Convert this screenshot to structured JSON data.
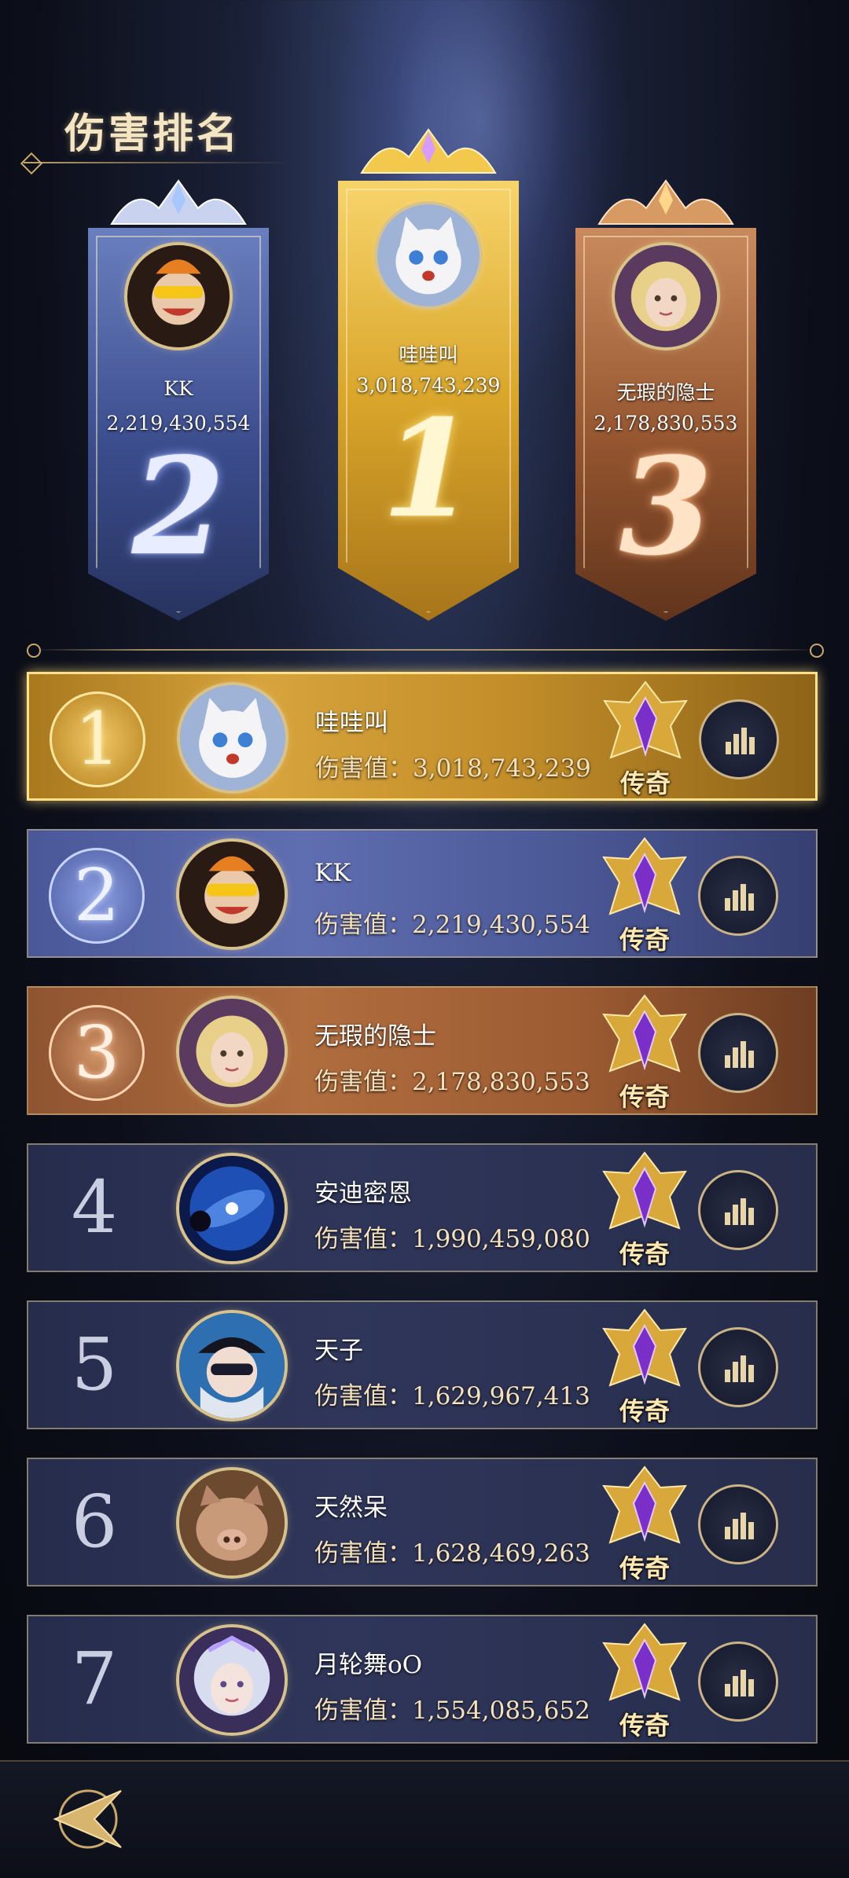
{
  "header": {
    "title": "伤害排名"
  },
  "podium": [
    {
      "rank": "2",
      "name": "KK",
      "score": "2,219,430,554",
      "avatar_icon": "masked-joker-avatar"
    },
    {
      "rank": "1",
      "name": "哇哇叫",
      "score": "3,018,743,239",
      "avatar_icon": "white-kitten-avatar"
    },
    {
      "rank": "3",
      "name": "无瑕的隐士",
      "score": "2,178,830,553",
      "avatar_icon": "blonde-lady-avatar"
    }
  ],
  "rankings": [
    {
      "rank": "1",
      "name": "哇哇叫",
      "score": "伤害值：3,018,743,239",
      "tier": "传奇",
      "avatar_icon": "white-kitten-avatar"
    },
    {
      "rank": "2",
      "name": "KK",
      "score": "伤害值：2,219,430,554",
      "tier": "传奇",
      "avatar_icon": "masked-joker-avatar"
    },
    {
      "rank": "3",
      "name": "无瑕的隐士",
      "score": "伤害值：2,178,830,553",
      "tier": "传奇",
      "avatar_icon": "blonde-lady-avatar"
    },
    {
      "rank": "4",
      "name": "安迪密恩",
      "score": "伤害值：1,990,459,080",
      "tier": "传奇",
      "avatar_icon": "galaxy-orb-avatar"
    },
    {
      "rank": "5",
      "name": "天子",
      "score": "伤害值：1,629,967,413",
      "tier": "传奇",
      "avatar_icon": "sunglasses-hat-avatar"
    },
    {
      "rank": "6",
      "name": "天然呆",
      "score": "伤害值：1,628,469,263",
      "tier": "传奇",
      "avatar_icon": "boar-avatar"
    },
    {
      "rank": "7",
      "name": "月轮舞oO",
      "score": "伤害值：1,554,085,652",
      "tier": "传奇",
      "avatar_icon": "silver-hair-girl-avatar"
    }
  ],
  "colors": {
    "gold": "#d9a52a",
    "silver_blue": "#5f6eb1",
    "bronze": "#b06d3e",
    "row_dark": "#2f365a",
    "accent_text": "#f5e2bd"
  },
  "footer": {
    "back_icon": "back-arrow-icon"
  }
}
